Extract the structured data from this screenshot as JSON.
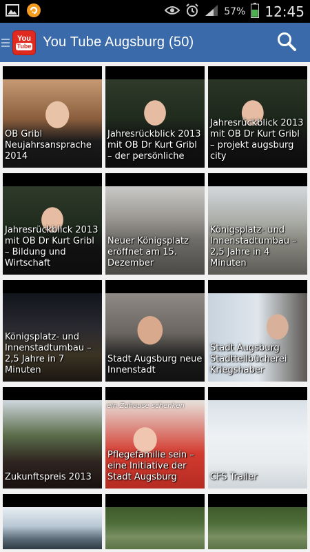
{
  "status_bar": {
    "battery_percent": "57%",
    "clock": "12:45",
    "icons": [
      "image-icon",
      "notification-app-icon",
      "eye-icon",
      "alarm-icon",
      "signal-icon",
      "battery-icon"
    ]
  },
  "app_bar": {
    "title": "You Tube Augsburg (50)",
    "logo_text_top": "You",
    "logo_text_bottom": "Tube",
    "search_icon": "search-icon"
  },
  "colors": {
    "action_bar": "#3a6aa9",
    "status_bar": "#000000",
    "background": "#f2f2f2",
    "logo_red": "#e02a20"
  },
  "videos": [
    {
      "title": "OB Gribl Neujahrsansprache 2014",
      "scene": "hall"
    },
    {
      "title": "Jahresrückblick 2013 mit OB Dr Kurt Gribl – der persönliche",
      "scene": "tree"
    },
    {
      "title": "Jahresrückblick 2013 mit OB Dr Kurt Gribl – projekt augsburg city",
      "scene": "tree2"
    },
    {
      "title": "Jahresrückblick 2013 mit OB Dr Kurt Gribl – Bildung und Wirtschaft",
      "scene": "tree"
    },
    {
      "title": "Neuer Königsplatz eröffnet am 15. Dezember",
      "scene": "street"
    },
    {
      "title": "Königsplatz- und Innenstadtumbau – 2,5 Jahre in 4 Minuten",
      "scene": "construction"
    },
    {
      "title": "Königsplatz- und Innenstadtumbau – 2,5 Jahre in 7 Minuten",
      "scene": "night"
    },
    {
      "title": "Stadt Augsburg neue Innenstadt",
      "scene": "street2"
    },
    {
      "title": "Stadt Augsburg Stadtteilbücherei Kriegshaber",
      "scene": "office"
    },
    {
      "title": "Zukunftspreis 2013",
      "scene": "stage"
    },
    {
      "title": "Pflegefamilie sein – eine Initiative der Stadt Augsburg",
      "scene": "family",
      "overlay": "ein Zuhause schenken"
    },
    {
      "title": "CFS Trailer",
      "scene": "hockey"
    },
    {
      "title": "",
      "scene": "building"
    },
    {
      "title": "",
      "scene": "park"
    },
    {
      "title": "",
      "scene": "park"
    }
  ]
}
